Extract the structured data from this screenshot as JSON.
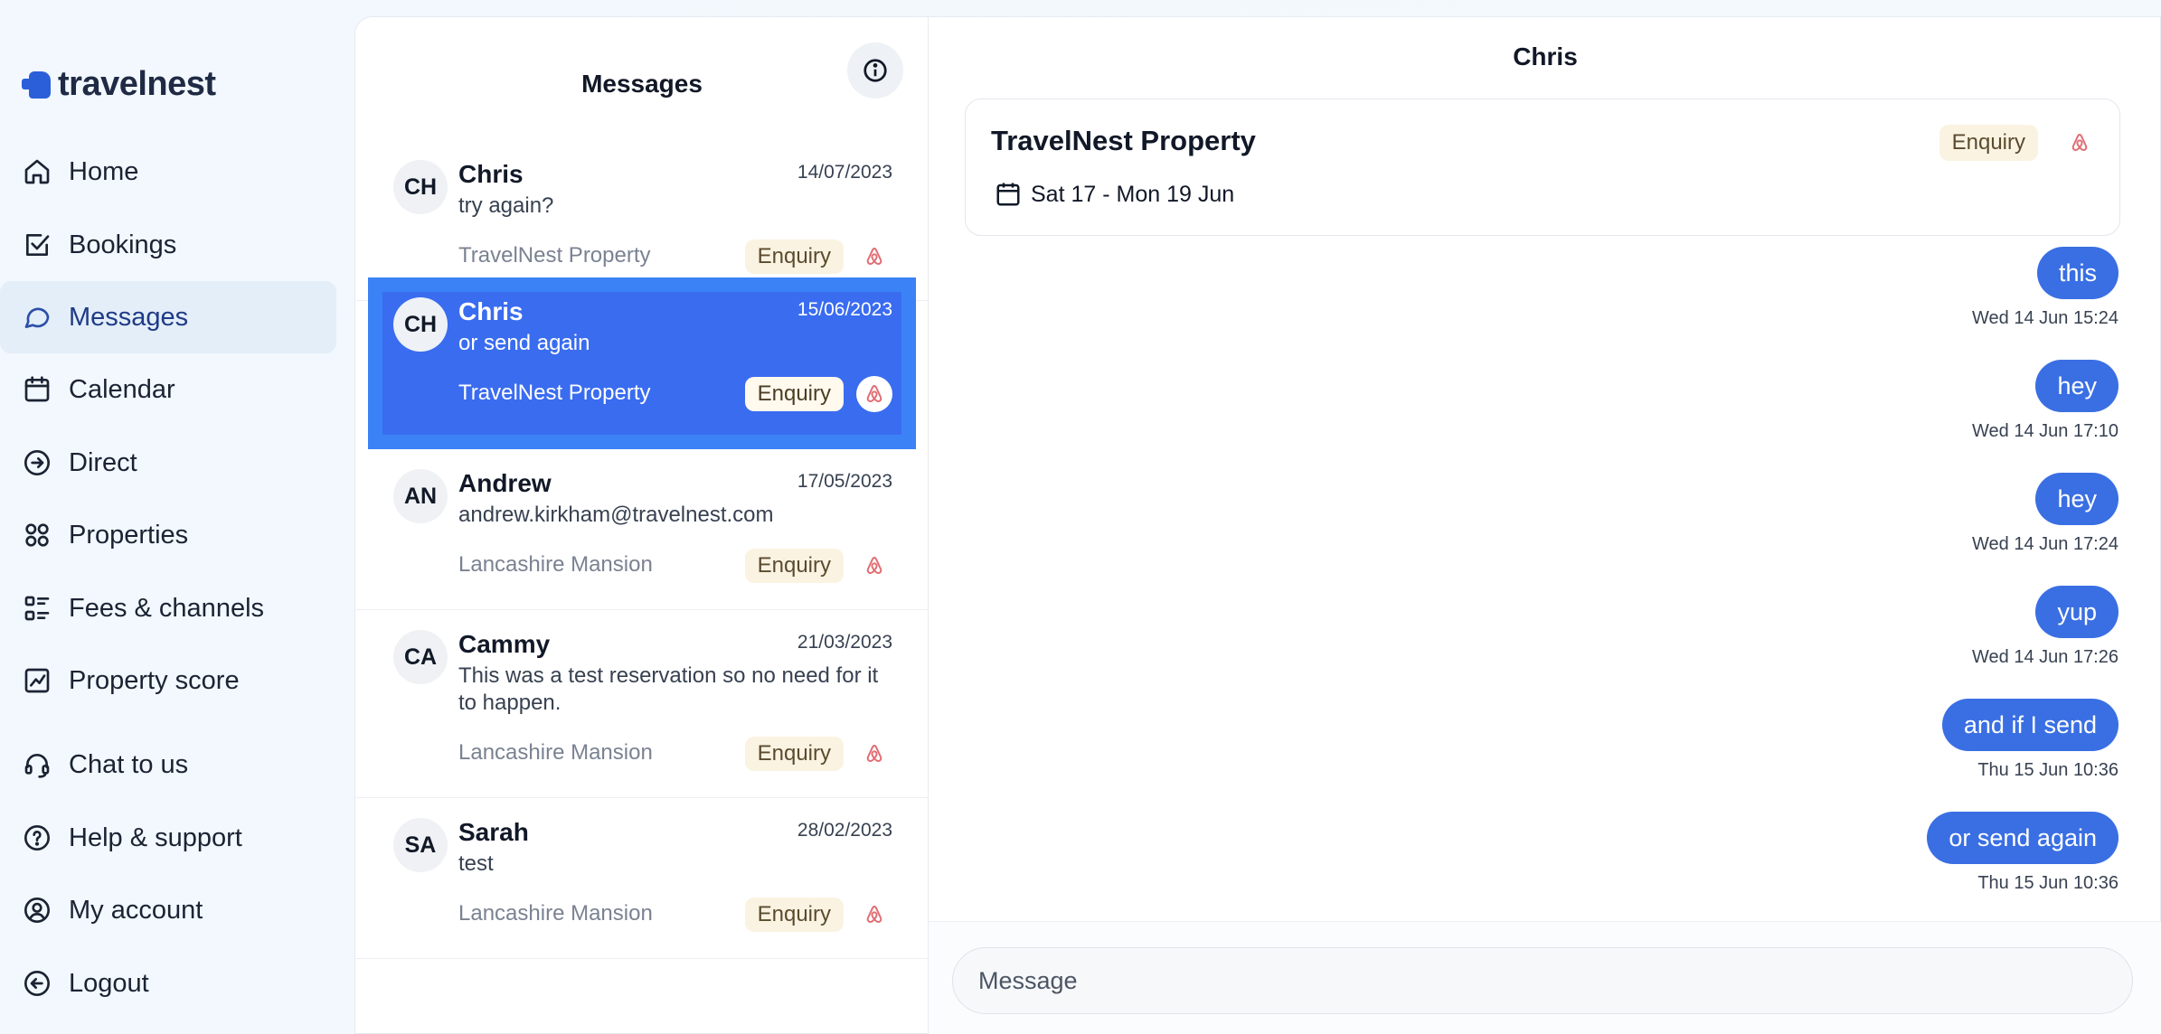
{
  "brand": {
    "name": "travelnest"
  },
  "sidebar": {
    "items": [
      {
        "label": "Home",
        "icon": "home-icon"
      },
      {
        "label": "Bookings",
        "icon": "checkbox-icon"
      },
      {
        "label": "Messages",
        "icon": "chat-bubble-icon",
        "active": true
      },
      {
        "label": "Calendar",
        "icon": "calendar-icon"
      },
      {
        "label": "Direct",
        "icon": "arrow-circle-icon"
      },
      {
        "label": "Properties",
        "icon": "grid-icon"
      },
      {
        "label": "Fees & channels",
        "icon": "list-icon"
      },
      {
        "label": "Property score",
        "icon": "chart-icon"
      },
      {
        "label": "Chat to us",
        "icon": "headset-icon"
      },
      {
        "label": "Help & support",
        "icon": "help-icon"
      },
      {
        "label": "My account",
        "icon": "user-circle-icon"
      },
      {
        "label": "Logout",
        "icon": "logout-icon"
      }
    ]
  },
  "conversations": {
    "title": "Messages",
    "items": [
      {
        "initials": "CH",
        "name": "Chris",
        "date": "14/07/2023",
        "preview": "try again?",
        "property": "TravelNest Property",
        "status": "Enquiry"
      },
      {
        "initials": "CH",
        "name": "Chris",
        "date": "15/06/2023",
        "preview": "or send again",
        "property": "TravelNest Property",
        "status": "Enquiry",
        "selected": true
      },
      {
        "initials": "AN",
        "name": "Andrew",
        "date": "17/05/2023",
        "preview": "andrew.kirkham@travelnest.com",
        "property": "Lancashire Mansion",
        "status": "Enquiry"
      },
      {
        "initials": "CA",
        "name": "Cammy",
        "date": "21/03/2023",
        "preview": "This was a test reservation so no need for it to happen.",
        "property": "Lancashire Mansion",
        "status": "Enquiry"
      },
      {
        "initials": "SA",
        "name": "Sarah",
        "date": "28/02/2023",
        "preview": "test",
        "property": "Lancashire Mansion",
        "status": "Enquiry"
      }
    ]
  },
  "chat": {
    "title": "Chris",
    "property_name": "TravelNest Property",
    "status": "Enquiry",
    "dates": "Sat 17 - Mon 19 Jun",
    "messages": [
      {
        "text": "this",
        "time": "Wed 14 Jun 15:24"
      },
      {
        "text": "hey",
        "time": "Wed 14 Jun 17:10"
      },
      {
        "text": "hey",
        "time": "Wed 14 Jun 17:24"
      },
      {
        "text": "yup",
        "time": "Wed 14 Jun 17:26"
      },
      {
        "text": "and if I send",
        "time": "Thu 15 Jun 10:36"
      },
      {
        "text": "or send again",
        "time": "Thu 15 Jun 10:36"
      }
    ],
    "composer_placeholder": "Message"
  },
  "colors": {
    "accent": "#3a6fe3",
    "selected_row": "#3a6cf0",
    "badge_bg": "#fbf3e2",
    "airbnb": "#e26d74"
  }
}
